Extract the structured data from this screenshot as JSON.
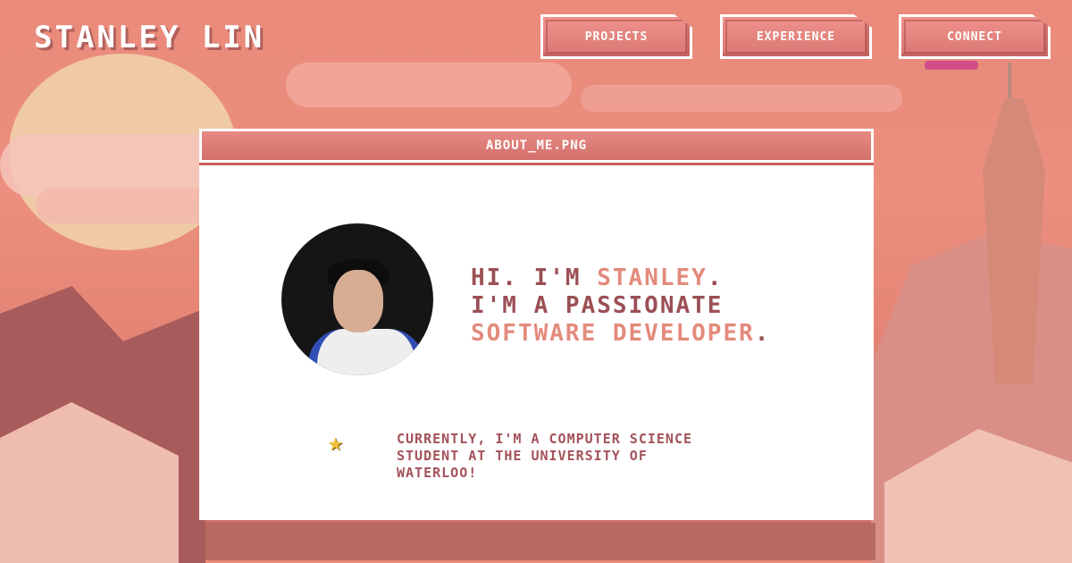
{
  "header": {
    "brand": "STANLEY LIN",
    "nav": [
      {
        "label": "PROJECTS"
      },
      {
        "label": "EXPERIENCE"
      },
      {
        "label": "CONNECT"
      }
    ]
  },
  "window": {
    "title": "ABOUT_ME.PNG",
    "headline": {
      "line1_prefix": "HI. I'M ",
      "line1_name": "STANLEY",
      "line1_suffix": ".",
      "line2": "I'M A PASSIONATE",
      "line3_role": "SOFTWARE DEVELOPER",
      "line3_suffix": "."
    },
    "fact": {
      "icon": "star-icon",
      "text": "CURRENTLY, I'M A COMPUTER SCIENCE STUDENT AT THE UNIVERSITY OF WATERLOO!"
    }
  },
  "colors": {
    "accent": "#e38a7c",
    "headline": "#9b4f55",
    "button": "#d97672",
    "background": "#e98a7a"
  }
}
